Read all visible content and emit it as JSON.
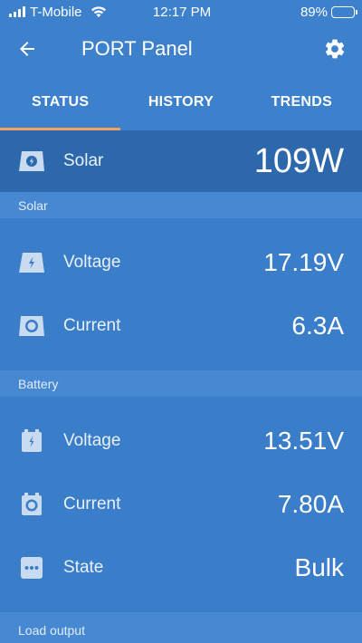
{
  "status_bar": {
    "carrier": "T-Mobile",
    "time": "12:17 PM",
    "battery_percent": "89%",
    "battery_level": 0.89
  },
  "header": {
    "title": "PORT Panel",
    "back_icon": "arrow-left-icon",
    "settings_icon": "gear-icon"
  },
  "tabs": [
    {
      "label": "STATUS",
      "active": true
    },
    {
      "label": "HISTORY",
      "active": false
    },
    {
      "label": "TRENDS",
      "active": false
    }
  ],
  "summary": {
    "label": "Solar",
    "value": "109W",
    "icon": "solar-panel-icon"
  },
  "sections": {
    "solar": {
      "title": "Solar",
      "voltage": {
        "label": "Voltage",
        "value": "17.19V",
        "icon": "solar-voltage-icon"
      },
      "current": {
        "label": "Current",
        "value": "6.3A",
        "icon": "solar-current-icon"
      }
    },
    "battery": {
      "title": "Battery",
      "voltage": {
        "label": "Voltage",
        "value": "13.51V",
        "icon": "battery-voltage-icon"
      },
      "current": {
        "label": "Current",
        "value": "7.80A",
        "icon": "battery-current-icon"
      },
      "state": {
        "label": "State",
        "value": "Bulk",
        "icon": "more-icon"
      }
    },
    "load": {
      "title": "Load output"
    }
  },
  "colors": {
    "background": "#3a7dc9",
    "primary_row": "#2d68ad",
    "section_header": "#4788d2",
    "tab_indicator": "#f5a25d",
    "icon_fill": "#c9dbf1"
  }
}
